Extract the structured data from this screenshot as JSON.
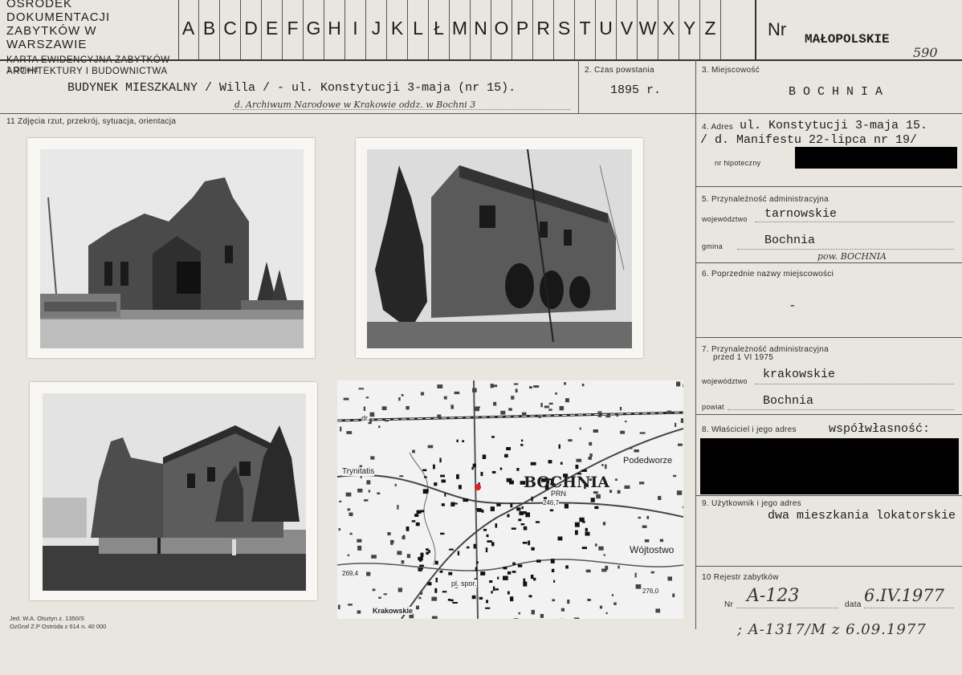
{
  "header": {
    "office_line1": "OŚRODEK DOKUMENTACJI",
    "office_line2": "ZABYTKÓW W WARSZAWIE",
    "office_line3": "KARTA EWIDENCYJNA ZABYTKÓW",
    "office_line4": "ARCHITEKTURY I BUDOWNICTWA",
    "letters": [
      "A",
      "B",
      "C",
      "D",
      "E",
      "F",
      "G",
      "H",
      "I",
      "J",
      "K",
      "L",
      "Ł",
      "M",
      "N",
      "O",
      "P",
      "R",
      "S",
      "T",
      "U",
      "V",
      "W",
      "X",
      "Y",
      "Z"
    ],
    "nr_label": "Nr",
    "region": "MAŁOPOLSKIE",
    "number": "590"
  },
  "field1": {
    "label": "1 Obiekt",
    "value": "BUDYNEK MIESZKALNY / Willa / - ul. Konstytucji 3-maja (nr 15).",
    "handwritten": "d. Archiwum Narodowe w Krakowie oddz. w Bochni 3"
  },
  "field2": {
    "label": "2. Czas powstania",
    "value": "1895 r."
  },
  "field3": {
    "label": "3. Miejscowość",
    "value": "B O C H N I A"
  },
  "field11": {
    "label": "11 Zdjęcia rzut, przekrój, sytuacja, orientacja"
  },
  "field4": {
    "label": "4. Adres",
    "line1": "ul. Konstytucji 3-maja 15.",
    "line2": "/ d. Manifestu 22-lipca nr 19/",
    "hipoteczny_label": "nr hipoteczny"
  },
  "field5": {
    "label": "5. Przynależność administracyjna",
    "woj_label": "województwo",
    "woj_value": "tarnowskie",
    "gmina_label": "gmina",
    "gmina_value": "Bochnia",
    "handwritten": "pow. BOCHNIA"
  },
  "field6": {
    "label": "6. Poprzednie nazwy miejscowości",
    "value": "-"
  },
  "field7": {
    "label": "7. Przynależność administracyjna",
    "label2": "przed 1 VI 1975",
    "woj_label": "województwo",
    "woj_value": "krakowskie",
    "powiat_label": "powiat",
    "powiat_value": "Bochnia"
  },
  "field8": {
    "label": "8. Właściciel i jego adres",
    "value": "współwłasność:"
  },
  "field9": {
    "label": "9. Użytkownik i jego adres",
    "value": "dwa mieszkania lokatorskie"
  },
  "field10": {
    "label": "10 Rejestr zabytków",
    "nr_label": "Nr",
    "nr_value": "A-123",
    "data_label": "data",
    "data_value": "6.IV.1977",
    "extra": "; A-1317/M z 6.09.1977"
  },
  "map": {
    "town": "BOCHNIA",
    "places": [
      "Trynitatis",
      "Podedworze",
      "Wójtostwo",
      "Krakowskie",
      "PRN",
      "dr.",
      "pl. spor."
    ],
    "heights": [
      "246,7",
      "269,4",
      "276,0"
    ]
  },
  "footer": {
    "line1": "Jed. W.A. Olsztyn z. 1350/S",
    "line2": "OzGraf Z.P Ostróda z 614 n. 40 000"
  },
  "colors": {
    "paper": "#e9e6df",
    "ink": "#1d1d1d",
    "stamp_red": "#d22"
  }
}
